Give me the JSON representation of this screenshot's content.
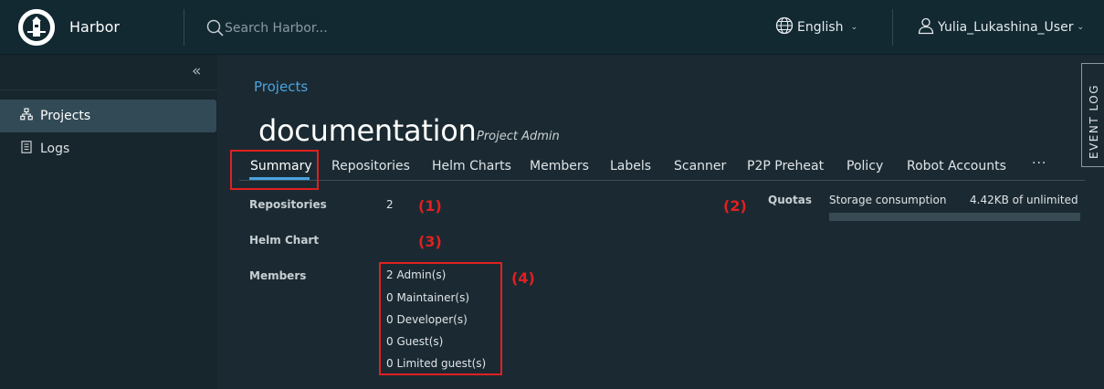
{
  "header": {
    "app_title": "Harbor",
    "search_placeholder": "Search Harbor...",
    "language": "English",
    "user": "Yulia_Lukashina_User"
  },
  "sidebar": {
    "items": [
      {
        "label": "Projects",
        "icon": "projects-icon",
        "active": true
      },
      {
        "label": "Logs",
        "icon": "logs-icon",
        "active": false
      }
    ]
  },
  "breadcrumb": "Projects",
  "project": {
    "name": "documentation",
    "role": "Project Admin"
  },
  "tabs": [
    "Summary",
    "Repositories",
    "Helm Charts",
    "Members",
    "Labels",
    "Scanner",
    "P2P Preheat",
    "Policy",
    "Robot Accounts"
  ],
  "tabs_more": "···",
  "summary": {
    "repositories_label": "Repositories",
    "repositories_value": "2",
    "helm_chart_label": "Helm Chart",
    "members_label": "Members",
    "members": [
      "2 Admin(s)",
      "0 Maintainer(s)",
      "0 Developer(s)",
      "0 Guest(s)",
      "0 Limited guest(s)"
    ],
    "quotas_label": "Quotas",
    "storage_label": "Storage consumption",
    "storage_value": "4.42KB of unlimited"
  },
  "annotations": [
    "(1)",
    "(2)",
    "(3)",
    "(4)"
  ],
  "event_log": "EVENT LOG",
  "colors": {
    "accent": "#4aa3df",
    "annotation": "#e02020",
    "header_bg": "#122932",
    "sidebar_bg": "#17252c",
    "main_bg": "#1b2a32"
  }
}
